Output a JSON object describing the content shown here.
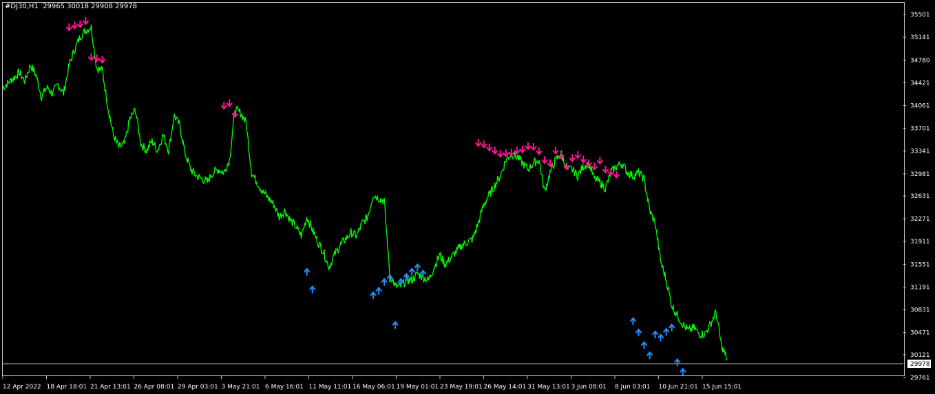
{
  "header": {
    "symbol_timeframe": "#DJ30,H1",
    "ohlc": "29965 30018 29908 29978"
  },
  "price_tag": "29978",
  "colors": {
    "background": "#000000",
    "price_line": "#00ff00",
    "sell_arrow": "#ff1493",
    "buy_arrow": "#1e90ff",
    "frame": "#c8c8c8",
    "bid_line": "#b4b4b4"
  },
  "icons": {
    "sell_signal": "arrow-down-icon",
    "buy_signal": "arrow-up-icon"
  },
  "chart_data": {
    "type": "line",
    "title": "",
    "xlabel": "",
    "ylabel": "",
    "y_ticks": [
      35501,
      35141,
      34780,
      34421,
      34061,
      33701,
      33341,
      32981,
      32631,
      32271,
      31911,
      31551,
      31191,
      30831,
      30471,
      30121,
      29761
    ],
    "x_ticks": [
      "12 Apr 2022",
      "18 Apr 18:01",
      "21 Apr 13:01",
      "26 Apr 08:01",
      "29 Apr 03:01",
      "3 May 21:01",
      "6 May 16:01",
      "11 May 11:01",
      "16 May 06:01",
      "19 May 01:01",
      "23 May 19:01",
      "26 May 14:01",
      "31 May 13:01",
      "3 Jun 08:01",
      "8 Jun 03:01",
      "10 Jun 21:01",
      "15 Jun 15:01"
    ],
    "ylim": [
      29761,
      35501
    ],
    "last_price": 29978,
    "grid": false,
    "series": [
      {
        "values": [
          34350,
          34420,
          34500,
          34580,
          34450,
          34700,
          34550,
          34200,
          34350,
          34250,
          34400,
          34250,
          34700,
          34950,
          35150,
          35250,
          35300,
          34650,
          34620,
          34050,
          33600,
          33400,
          33450,
          33850,
          34000,
          33450,
          33350,
          33500,
          33350,
          33600,
          33350,
          33900,
          33750,
          33300,
          33050,
          32950,
          32900,
          32850,
          33000,
          33050,
          33000,
          33200,
          34000,
          33950,
          33800,
          33000,
          32850,
          32700,
          32600,
          32500,
          32300,
          32400,
          32250,
          32150,
          32000,
          32300,
          32100,
          31900,
          31750,
          31500,
          31700,
          31850,
          31950,
          32050,
          32000,
          32200,
          32300,
          32650,
          32600,
          32550,
          31400,
          31200,
          31200,
          31300,
          31300,
          31400,
          31350,
          31300,
          31500,
          31700,
          31550,
          31650,
          31750,
          31850,
          31900,
          31950,
          32200,
          32500,
          32650,
          32800,
          32950,
          33200,
          33300,
          33250,
          33150,
          33050,
          33150,
          33200,
          32700,
          33000,
          33200,
          33300,
          33050,
          33050,
          32950,
          33100,
          33150,
          32900,
          32850,
          32750,
          33000,
          33100,
          33150,
          33000,
          32950,
          33000,
          32900,
          32400,
          32200,
          31600,
          31300,
          30900,
          30750,
          30600,
          30500,
          30550,
          30450,
          30450,
          30600,
          30800,
          30250,
          30050
        ]
      }
    ],
    "sell_signals": [
      {
        "x": 12,
        "y": 35250
      },
      {
        "x": 13,
        "y": 35280
      },
      {
        "x": 14,
        "y": 35300
      },
      {
        "x": 15,
        "y": 35350
      },
      {
        "x": 16,
        "y": 34780
      },
      {
        "x": 17,
        "y": 34760
      },
      {
        "x": 18,
        "y": 34740
      },
      {
        "x": 40,
        "y": 34010
      },
      {
        "x": 41,
        "y": 34050
      },
      {
        "x": 42,
        "y": 33880
      },
      {
        "x": 86,
        "y": 33420
      },
      {
        "x": 87,
        "y": 33400
      },
      {
        "x": 88,
        "y": 33350
      },
      {
        "x": 89,
        "y": 33300
      },
      {
        "x": 90,
        "y": 33250
      },
      {
        "x": 91,
        "y": 33260
      },
      {
        "x": 92,
        "y": 33270
      },
      {
        "x": 93,
        "y": 33300
      },
      {
        "x": 94,
        "y": 33320
      },
      {
        "x": 95,
        "y": 33370
      },
      {
        "x": 96,
        "y": 33360
      },
      {
        "x": 97,
        "y": 33290
      },
      {
        "x": 98,
        "y": 33150
      },
      {
        "x": 99,
        "y": 33100
      },
      {
        "x": 100,
        "y": 33300
      },
      {
        "x": 101,
        "y": 33220
      },
      {
        "x": 102,
        "y": 33050
      },
      {
        "x": 103,
        "y": 33180
      },
      {
        "x": 104,
        "y": 33230
      },
      {
        "x": 105,
        "y": 33160
      },
      {
        "x": 106,
        "y": 33100
      },
      {
        "x": 107,
        "y": 33050
      },
      {
        "x": 108,
        "y": 33140
      },
      {
        "x": 109,
        "y": 33000
      },
      {
        "x": 110,
        "y": 32960
      },
      {
        "x": 111,
        "y": 32920
      }
    ],
    "buy_signals": [
      {
        "x": 55,
        "y": 31480
      },
      {
        "x": 56,
        "y": 31200
      },
      {
        "x": 67,
        "y": 31110
      },
      {
        "x": 68,
        "y": 31180
      },
      {
        "x": 69,
        "y": 31320
      },
      {
        "x": 70,
        "y": 31380
      },
      {
        "x": 71,
        "y": 30640
      },
      {
        "x": 72,
        "y": 31320
      },
      {
        "x": 73,
        "y": 31400
      },
      {
        "x": 74,
        "y": 31480
      },
      {
        "x": 75,
        "y": 31550
      },
      {
        "x": 76,
        "y": 31450
      },
      {
        "x": 114,
        "y": 30700
      },
      {
        "x": 115,
        "y": 30520
      },
      {
        "x": 116,
        "y": 30320
      },
      {
        "x": 117,
        "y": 30160
      },
      {
        "x": 118,
        "y": 30490
      },
      {
        "x": 119,
        "y": 30440
      },
      {
        "x": 120,
        "y": 30530
      },
      {
        "x": 121,
        "y": 30600
      },
      {
        "x": 122,
        "y": 30050
      },
      {
        "x": 123,
        "y": 29900
      }
    ]
  }
}
